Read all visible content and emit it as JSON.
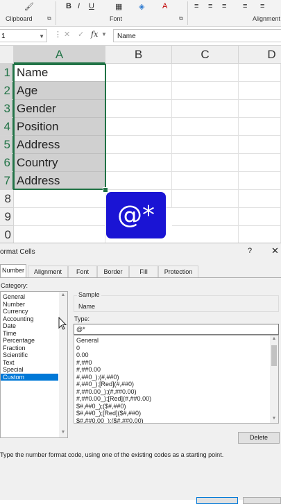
{
  "ribbon": {
    "clipboard_label": "Clipboard",
    "font_label": "Font",
    "alignment_label": "Alignment"
  },
  "formula_bar": {
    "name_box": "1",
    "fx_label": "fx",
    "content": "Name"
  },
  "grid": {
    "columns": [
      "A",
      "B",
      "C",
      "D"
    ],
    "rows": [
      "1",
      "2",
      "3",
      "4",
      "5",
      "6",
      "7",
      "8",
      "9",
      "0"
    ],
    "column_a_values": [
      "Name",
      "Age",
      "Gender",
      "Position",
      "Address",
      "Country",
      "Address"
    ]
  },
  "badge": {
    "text": "@*",
    "color": "#1a14d4"
  },
  "dialog": {
    "title": "ormat Cells",
    "help": "?",
    "tabs": [
      "Number",
      "Alignment",
      "Font",
      "Border",
      "Fill",
      "Protection"
    ],
    "active_tab": "Number",
    "category_label": "Category:",
    "categories": [
      "General",
      "Number",
      "Currency",
      "Accounting",
      "Date",
      "Time",
      "Percentage",
      "Fraction",
      "Scientific",
      "Text",
      "Special",
      "Custom"
    ],
    "selected_category": "Custom",
    "sample_label": "Sample",
    "sample_value": "Name",
    "type_label": "Type:",
    "type_value": "@*",
    "formats": [
      "General",
      "0",
      "0.00",
      "#,##0",
      "#,##0.00",
      "#,##0_);(#,##0)",
      "#,##0_);[Red](#,##0)",
      "#,##0.00_);(#,##0.00)",
      "#,##0.00_);[Red](#,##0.00)",
      "$#,##0_);($#,##0)",
      "$#,##0_);[Red]($#,##0)",
      "$#,##0.00_);($#,##0.00)"
    ],
    "delete_label": "Delete",
    "hint": "Type the number format code, using one of the existing codes as a starting point."
  },
  "colors": {
    "excel_green": "#217346",
    "selection_blue": "#0078d7"
  }
}
